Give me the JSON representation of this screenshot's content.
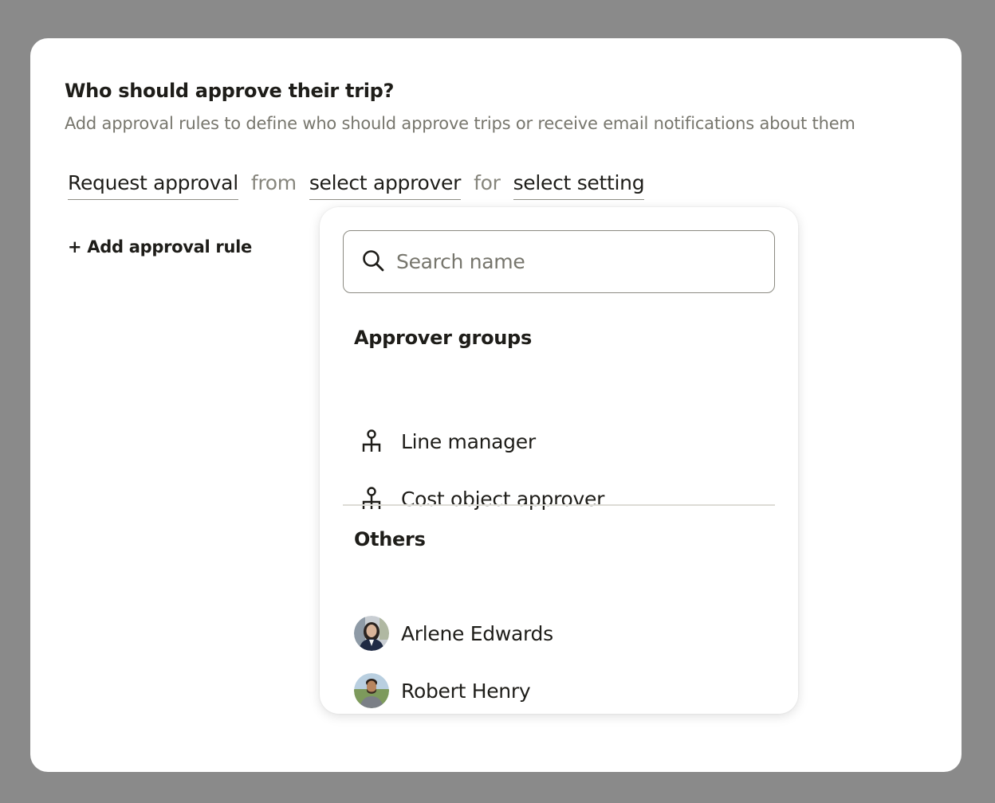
{
  "form": {
    "title": "Who should approve their trip?",
    "subtitle": "Add approval rules to define who should approve trips or receive email notifications about them"
  },
  "rule": {
    "action": "Request approval",
    "from_word": "from",
    "approver": "select approver",
    "for_word": "for",
    "setting": "select setting"
  },
  "add_rule_label": "+ Add approval rule",
  "dropdown": {
    "search_placeholder": "Search name",
    "search_value": "",
    "groups_heading": "Approver groups",
    "groups": [
      {
        "label": "Line manager",
        "icon": "org-chart-icon"
      },
      {
        "label": "Cost object approver",
        "icon": "org-chart-icon"
      }
    ],
    "others_heading": "Others",
    "people": [
      {
        "name": "Arlene Edwards",
        "icon": "avatar"
      },
      {
        "name": "Robert Henry",
        "icon": "avatar"
      }
    ]
  },
  "colors": {
    "backdrop": "#8a8a8a",
    "card": "#ffffff",
    "text": "#1e1d19",
    "muted": "#77766d",
    "border": "#8b8a81",
    "divider": "#dddcd6"
  }
}
